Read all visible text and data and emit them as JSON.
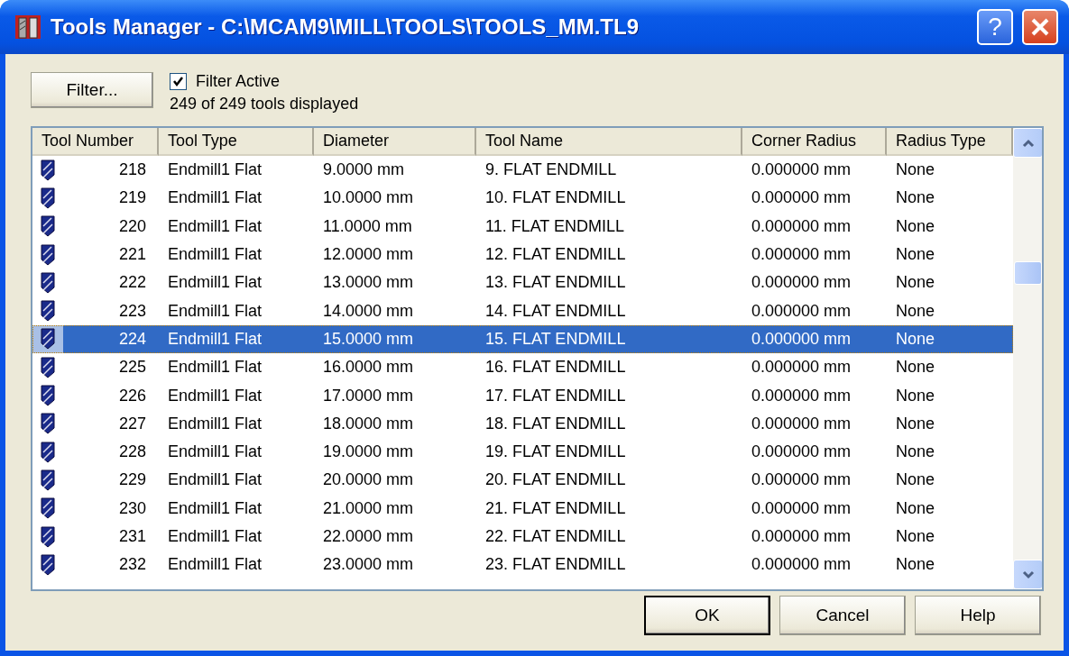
{
  "window": {
    "title": "Tools Manager - C:\\MCAM9\\MILL\\TOOLS\\TOOLS_MM.TL9"
  },
  "filter_button": "Filter...",
  "filter_active": {
    "label": "Filter Active",
    "checked": true
  },
  "status": "249 of 249 tools displayed",
  "table": {
    "columns": [
      "Tool Number",
      "Tool Type",
      "Diameter",
      "Tool Name",
      "Corner Radius",
      "Radius Type"
    ],
    "rows": [
      {
        "number": "218",
        "type": "Endmill1 Flat",
        "diameter": "9.0000 mm",
        "name": "9. FLAT ENDMILL",
        "corner_radius": "0.000000 mm",
        "radius_type": "None",
        "selected": false
      },
      {
        "number": "219",
        "type": "Endmill1 Flat",
        "diameter": "10.0000 mm",
        "name": "10. FLAT ENDMILL",
        "corner_radius": "0.000000 mm",
        "radius_type": "None",
        "selected": false
      },
      {
        "number": "220",
        "type": "Endmill1 Flat",
        "diameter": "11.0000 mm",
        "name": "11. FLAT ENDMILL",
        "corner_radius": "0.000000 mm",
        "radius_type": "None",
        "selected": false
      },
      {
        "number": "221",
        "type": "Endmill1 Flat",
        "diameter": "12.0000 mm",
        "name": "12. FLAT ENDMILL",
        "corner_radius": "0.000000 mm",
        "radius_type": "None",
        "selected": false
      },
      {
        "number": "222",
        "type": "Endmill1 Flat",
        "diameter": "13.0000 mm",
        "name": "13. FLAT ENDMILL",
        "corner_radius": "0.000000 mm",
        "radius_type": "None",
        "selected": false
      },
      {
        "number": "223",
        "type": "Endmill1 Flat",
        "diameter": "14.0000 mm",
        "name": "14. FLAT ENDMILL",
        "corner_radius": "0.000000 mm",
        "radius_type": "None",
        "selected": false
      },
      {
        "number": "224",
        "type": "Endmill1 Flat",
        "diameter": "15.0000 mm",
        "name": "15. FLAT ENDMILL",
        "corner_radius": "0.000000 mm",
        "radius_type": "None",
        "selected": true
      },
      {
        "number": "225",
        "type": "Endmill1 Flat",
        "diameter": "16.0000 mm",
        "name": "16. FLAT ENDMILL",
        "corner_radius": "0.000000 mm",
        "radius_type": "None",
        "selected": false
      },
      {
        "number": "226",
        "type": "Endmill1 Flat",
        "diameter": "17.0000 mm",
        "name": "17. FLAT ENDMILL",
        "corner_radius": "0.000000 mm",
        "radius_type": "None",
        "selected": false
      },
      {
        "number": "227",
        "type": "Endmill1 Flat",
        "diameter": "18.0000 mm",
        "name": "18. FLAT ENDMILL",
        "corner_radius": "0.000000 mm",
        "radius_type": "None",
        "selected": false
      },
      {
        "number": "228",
        "type": "Endmill1 Flat",
        "diameter": "19.0000 mm",
        "name": "19. FLAT ENDMILL",
        "corner_radius": "0.000000 mm",
        "radius_type": "None",
        "selected": false
      },
      {
        "number": "229",
        "type": "Endmill1 Flat",
        "diameter": "20.0000 mm",
        "name": "20. FLAT ENDMILL",
        "corner_radius": "0.000000 mm",
        "radius_type": "None",
        "selected": false
      },
      {
        "number": "230",
        "type": "Endmill1 Flat",
        "diameter": "21.0000 mm",
        "name": "21. FLAT ENDMILL",
        "corner_radius": "0.000000 mm",
        "radius_type": "None",
        "selected": false
      },
      {
        "number": "231",
        "type": "Endmill1 Flat",
        "diameter": "22.0000 mm",
        "name": "22. FLAT ENDMILL",
        "corner_radius": "0.000000 mm",
        "radius_type": "None",
        "selected": false
      },
      {
        "number": "232",
        "type": "Endmill1 Flat",
        "diameter": "23.0000 mm",
        "name": "23. FLAT ENDMILL",
        "corner_radius": "0.000000 mm",
        "radius_type": "None",
        "selected": false
      }
    ]
  },
  "buttons": [
    {
      "label": "OK",
      "default": true
    },
    {
      "label": "Cancel",
      "default": false
    },
    {
      "label": "Help",
      "default": false
    }
  ],
  "title_buttons": {
    "help": "?"
  }
}
